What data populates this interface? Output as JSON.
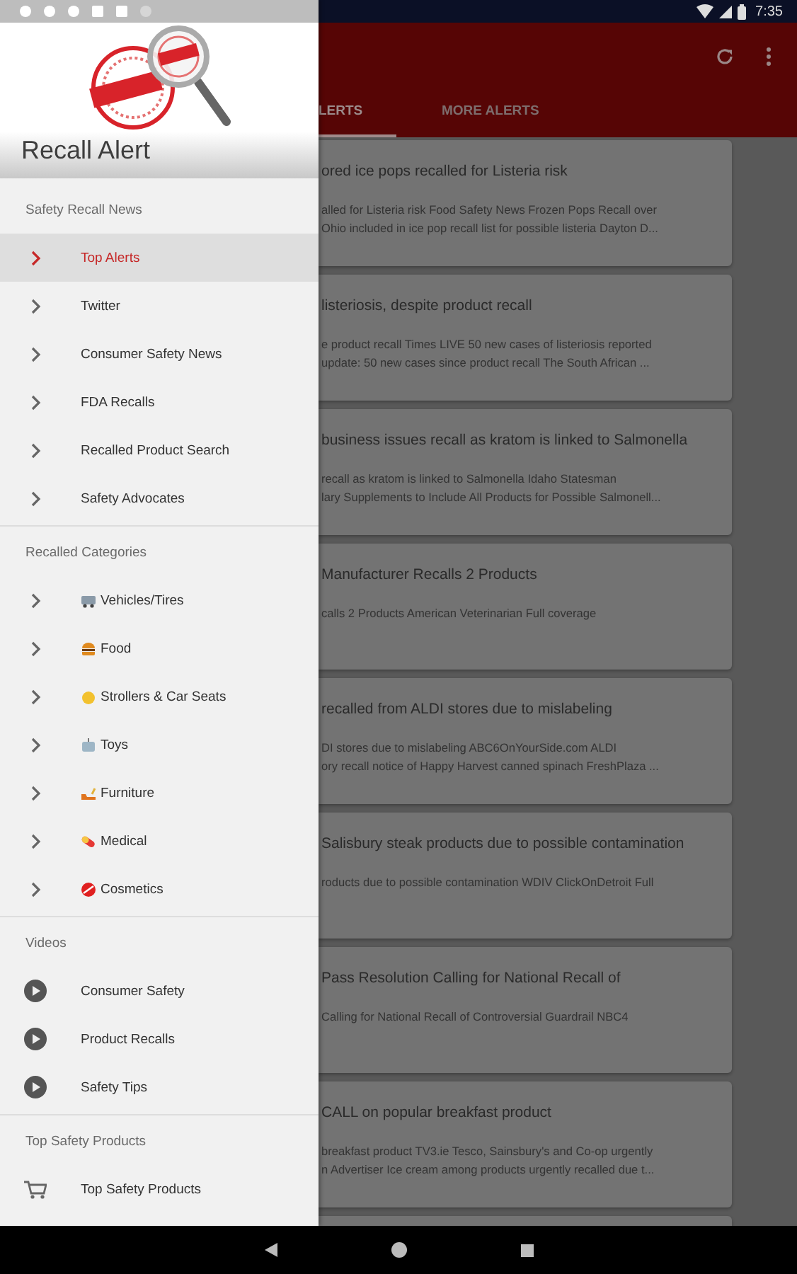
{
  "status_bar": {
    "time": "7:35"
  },
  "drawer": {
    "title": "Recall Alert",
    "sections": [
      {
        "heading": "Safety Recall News",
        "items": [
          {
            "label": "Top Alerts",
            "kind": "chevron",
            "selected": true
          },
          {
            "label": "Twitter",
            "kind": "chevron",
            "selected": false
          },
          {
            "label": "Consumer Safety News",
            "kind": "chevron",
            "selected": false
          },
          {
            "label": "FDA Recalls",
            "kind": "chevron",
            "selected": false
          },
          {
            "label": "Recalled Product Search",
            "kind": "chevron",
            "selected": false
          },
          {
            "label": "Safety Advocates",
            "kind": "chevron",
            "selected": false
          }
        ]
      },
      {
        "heading": "Recalled Categories",
        "items": [
          {
            "label": "Vehicles/Tires",
            "kind": "category",
            "selected": false
          },
          {
            "label": "Food",
            "kind": "category",
            "selected": false
          },
          {
            "label": "Strollers & Car Seats",
            "kind": "category",
            "selected": false
          },
          {
            "label": "Toys",
            "kind": "category",
            "selected": false
          },
          {
            "label": "Furniture",
            "kind": "category",
            "selected": false
          },
          {
            "label": "Medical",
            "kind": "category",
            "selected": false
          },
          {
            "label": "Cosmetics",
            "kind": "category",
            "selected": false
          }
        ]
      },
      {
        "heading": "Videos",
        "items": [
          {
            "label": "Consumer Safety",
            "kind": "play",
            "selected": false
          },
          {
            "label": "Product Recalls",
            "kind": "play",
            "selected": false
          },
          {
            "label": "Safety Tips",
            "kind": "play",
            "selected": false
          }
        ]
      },
      {
        "heading": "Top Safety Products",
        "items": [
          {
            "label": "Top Safety Products",
            "kind": "cart",
            "selected": false
          }
        ]
      }
    ]
  },
  "app": {
    "tabs": [
      {
        "label": "LERTS",
        "selected": true
      },
      {
        "label": "MORE ALERTS",
        "selected": false
      }
    ],
    "articles": [
      {
        "title": "ored ice pops recalled for Listeria risk",
        "snippet": [
          "alled for Listeria risk  Food Safety News  Frozen Pops Recall over",
          "Ohio included in ice pop recall list for possible listeria  Dayton D..."
        ]
      },
      {
        "title": "listeriosis, despite product recall",
        "snippet": [
          "e product recall  Times LIVE  50 new cases of listeriosis reported",
          "update: 50 new cases since product recall  The South African  ..."
        ]
      },
      {
        "title": "business issues recall as kratom is linked to Salmonella",
        "snippet": [
          "recall as kratom is linked to Salmonella  Idaho Statesman",
          "lary Supplements to Include All Products for Possible Salmonell..."
        ]
      },
      {
        "title": "Manufacturer Recalls 2 Products",
        "snippet": [
          "calls 2 Products  American Veterinarian  Full coverage"
        ]
      },
      {
        "title": "recalled from ALDI stores due to mislabeling",
        "snippet": [
          "DI stores due to mislabeling  ABC6OnYourSide.com  ALDI",
          "ory recall notice of Happy Harvest canned spinach  FreshPlaza  ..."
        ]
      },
      {
        "title": "Salisbury steak products due to possible contamination",
        "snippet": [
          "roducts due to possible contamination  WDIV ClickOnDetroit  Full"
        ]
      },
      {
        "title": "Pass Resolution Calling for National Recall of",
        "snippet": [
          "Calling for National Recall of Controversial Guardrail  NBC4"
        ]
      },
      {
        "title": "CALL on popular breakfast product",
        "snippet": [
          "breakfast product  TV3.ie  Tesco, Sainsbury's and Co-op urgently",
          "n Advertiser  Ice cream among products urgently recalled due t..."
        ]
      }
    ]
  }
}
